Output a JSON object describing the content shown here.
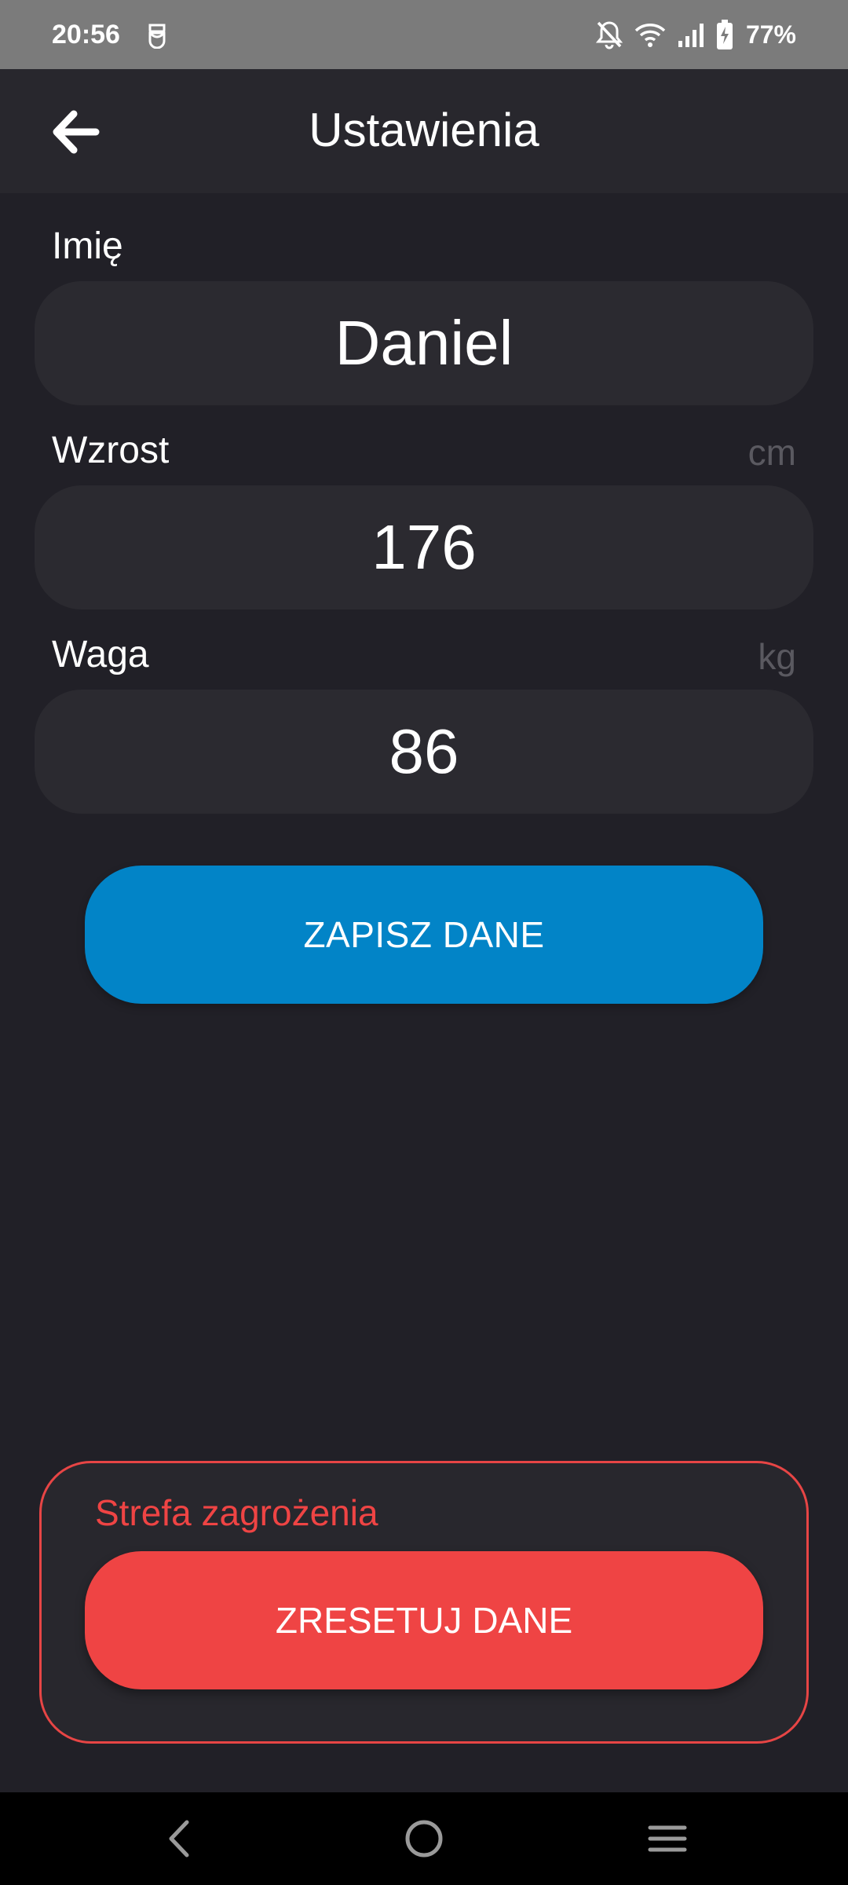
{
  "status_bar": {
    "time": "20:56",
    "app_icon": "app-notification-icon",
    "icons": [
      "bell-off-icon",
      "wifi-icon",
      "signal-icon",
      "battery-charging-icon"
    ],
    "battery": "77%"
  },
  "app_bar": {
    "back_icon": "arrow-left-icon",
    "title": "Ustawienia"
  },
  "form": {
    "name": {
      "label": "Imię",
      "value": "Daniel"
    },
    "height": {
      "label": "Wzrost",
      "unit": "cm",
      "value": "176"
    },
    "weight": {
      "label": "Waga",
      "unit": "kg",
      "value": "86"
    },
    "save_label": "ZAPISZ DANE"
  },
  "danger_zone": {
    "title": "Strefa zagrożenia",
    "reset_label": "ZRESETUJ DANE"
  },
  "nav_bar": {
    "icons": [
      "back-nav-icon",
      "home-nav-icon",
      "recents-nav-icon"
    ]
  },
  "colors": {
    "background": "#212027",
    "surface": "#2b2a30",
    "primary": "#0284c7",
    "danger": "#ef4444",
    "unit_text": "#5a5960"
  }
}
